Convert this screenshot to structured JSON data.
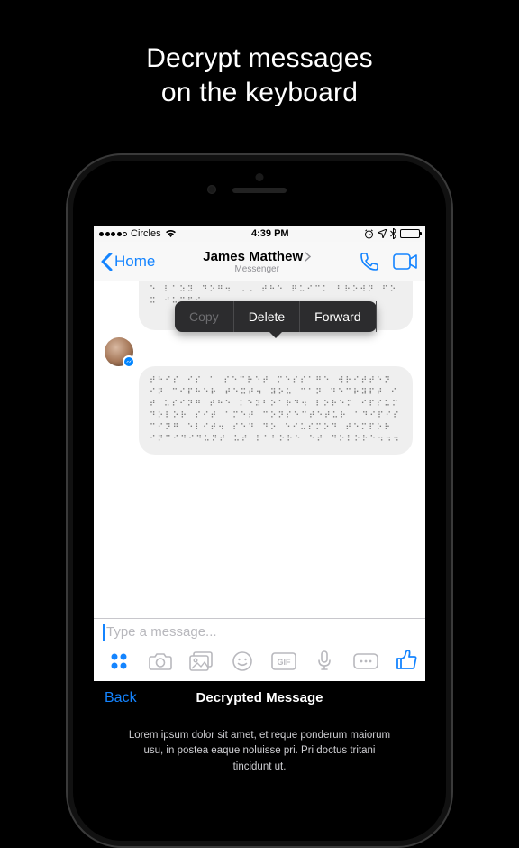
{
  "hero": {
    "line1": "Decrypt messages",
    "line2": "on the keyboard"
  },
  "statusbar": {
    "carrier": "Circles",
    "time": "4:39 PM"
  },
  "nav": {
    "back_label": "Home",
    "title": "James Matthew",
    "subtitle": "Messenger"
  },
  "bubbles": {
    "b1": "⠞⠓⠑ ⠟⠥⠊⠉⠅ ⠃⠗⠕⠺⠝ ⠋⠕⠭ ⠚⠥⠍⠏⠎ ⠕⠧⠑⠗ ⠞⠓⠑ ⠇⠁⠵⠽ ⠙⠕⠛⠲ ⠠⠠ ⠞⠓⠑ ⠟⠥⠊⠉⠅ ⠃⠗⠕⠺⠝ ⠋⠕⠭ ⠚⠥⠍⠏⠎",
    "b2": "⠞⠓⠊⠎ ⠊⠎ ⠁ ⠎⠑⠉⠗⠑⠞ ⠍⠑⠎⠎⠁⠛⠑ ⠺⠗⠊⠞⠞⠑⠝ ⠊⠝ ⠉⠊⠏⠓⠑⠗ ⠞⠑⠭⠞⠲ ⠽⠕⠥ ⠉⠁⠝ ⠙⠑⠉⠗⠽⠏⠞ ⠊⠞ ⠥⠎⠊⠝⠛ ⠞⠓⠑ ⠅⠑⠽⠃⠕⠁⠗⠙⠲ ⠇⠕⠗⠑⠍ ⠊⠏⠎⠥⠍ ⠙⠕⠇⠕⠗ ⠎⠊⠞ ⠁⠍⠑⠞ ⠉⠕⠝⠎⠑⠉⠞⠑⠞⠥⠗ ⠁⠙⠊⠏⠊⠎⠉⠊⠝⠛ ⠑⠇⠊⠞⠲ ⠎⠑⠙ ⠙⠕ ⠑⠊⠥⠎⠍⠕⠙ ⠞⠑⠍⠏⠕⠗ ⠊⠝⠉⠊⠙⠊⠙⠥⠝⠞ ⠥⠞ ⠇⠁⠃⠕⠗⠑ ⠑⠞ ⠙⠕⠇⠕⠗⠑⠲⠲⠲"
  },
  "context_menu": {
    "copy": "Copy",
    "delete": "Delete",
    "forward": "Forward"
  },
  "composer": {
    "placeholder": "Type a message..."
  },
  "decrypt": {
    "back": "Back",
    "title": "Decrypted Message",
    "body": "Lorem ipsum dolor sit amet, et reque ponderum maiorum usu, in postea eaque noluisse pri. Pri doctus tritani tincidunt ut."
  }
}
